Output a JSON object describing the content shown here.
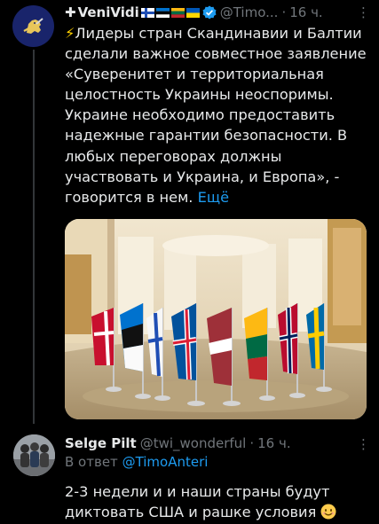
{
  "tweet": {
    "author_prefix": "✚",
    "author_name": "VeniVidi",
    "flags": [
      "finland-flag",
      "estonia-flag",
      "lithuania-flag",
      "ukraine-flag"
    ],
    "verified": true,
    "handle": "@Timo...",
    "separator": "·",
    "time": "16 ч.",
    "more_icon": "⋮",
    "lightning_icon": "⚡",
    "body": "Лидеры стран Скандинавии и Балтии сделали важное совместное заявление «Суверенитет и территориальная целостность Украины неоспоримы. Украине необходимо предоставить надежные гарантии безопасности. В любых переговорах должны участвовать и Украина, и Европа», - говорится в нем.",
    "show_more_label": "Ещё",
    "image_alt": "Flags of Nordic and Baltic countries on a table",
    "image_flags": [
      "denmark",
      "estonia",
      "finland",
      "iceland",
      "latvia",
      "lithuania",
      "norway",
      "sweden"
    ]
  },
  "reply": {
    "author_name": "Selge Pilt",
    "handle": "@twi_wonderful",
    "separator": "·",
    "time": "16 ч.",
    "more_icon": "⋮",
    "replying_prefix": "В ответ",
    "replying_mention": "@TimoAnteri",
    "body": "2-3 недели и и наши страны будут диктовать США и рашке условия",
    "emoji": "smiling-face-emoji"
  },
  "colors": {
    "background": "#000000",
    "text": "#e7e9ea",
    "muted": "#71767b",
    "link": "#1d9bf0",
    "verified": "#1d9bf0"
  }
}
